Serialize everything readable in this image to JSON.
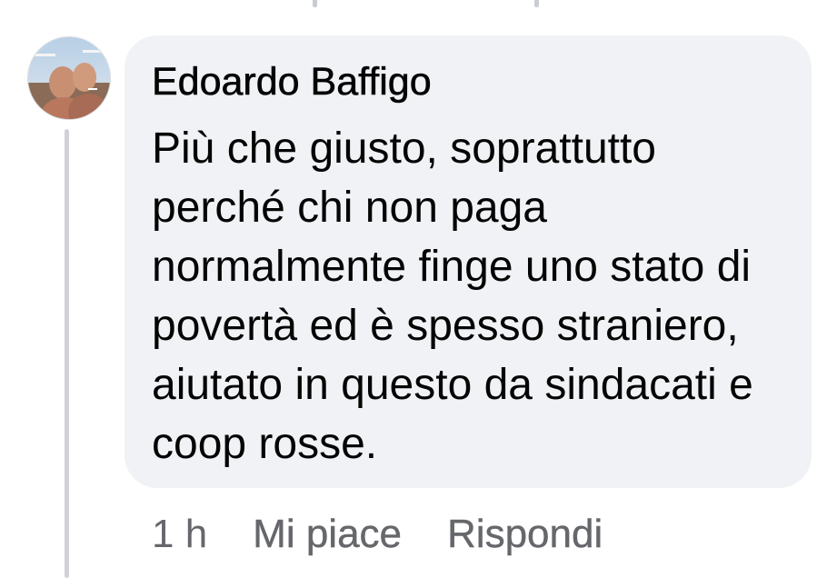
{
  "comment": {
    "author": "Edoardo Baffigo",
    "text": "Più che giusto, soprattutto perché chi non paga normalmente finge uno stato di povertà ed è spesso straniero, aiutato in questo da sindacati e coop rosse.",
    "time": "1 h",
    "like_label": "Mi piace",
    "reply_label": "Rispondi"
  },
  "colors": {
    "bubble_background": "#f0f2f5",
    "text_primary": "#050505",
    "text_secondary": "#65676b",
    "thread_line": "#d0d2d6"
  }
}
